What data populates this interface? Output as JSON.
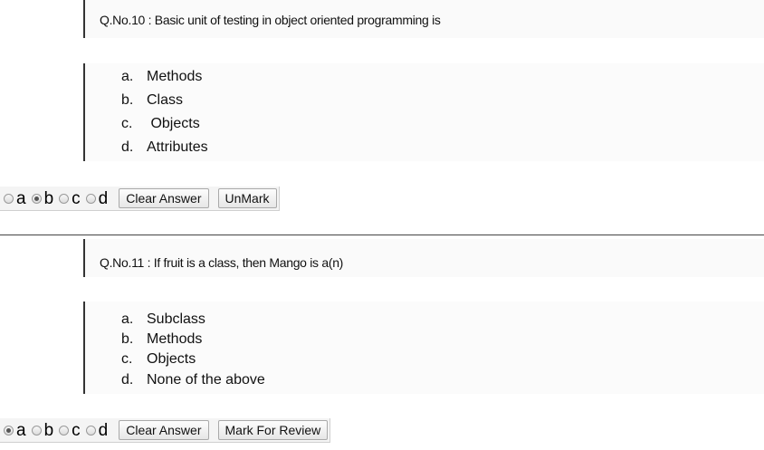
{
  "questions": [
    {
      "text": "Q.No.10 : Basic unit of testing in object oriented programming is",
      "options": [
        {
          "letter": "a.",
          "label": "Methods"
        },
        {
          "letter": "b.",
          "label": "Class"
        },
        {
          "letter": "c.",
          "label": " Objects"
        },
        {
          "letter": "d.",
          "label": "Attributes"
        }
      ],
      "answer": {
        "choices": [
          "a",
          "b",
          "c",
          "d"
        ],
        "selected": "b",
        "clear_label": "Clear Answer",
        "mark_label": "UnMark"
      }
    },
    {
      "text": "Q.No.11 : If fruit is a class, then Mango is a(n)",
      "options": [
        {
          "letter": "a.",
          "label": "Subclass"
        },
        {
          "letter": "b.",
          "label": "Methods"
        },
        {
          "letter": "c.",
          "label": "Objects"
        },
        {
          "letter": "d.",
          "label": "None of the above"
        }
      ],
      "answer": {
        "choices": [
          "a",
          "b",
          "c",
          "d"
        ],
        "selected": "a",
        "clear_label": "Clear Answer",
        "mark_label": "Mark For Review"
      }
    }
  ]
}
